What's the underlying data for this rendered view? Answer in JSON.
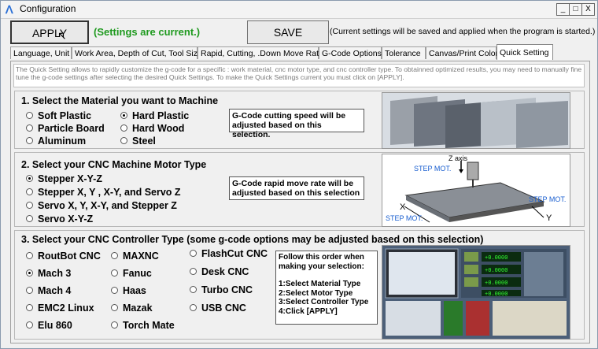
{
  "window": {
    "title": "Configuration",
    "controls": [
      "_",
      "□",
      "X"
    ]
  },
  "toolbar": {
    "apply_label": "APPLY",
    "status": "(Settings are current.)",
    "save_label": "SAVE",
    "save_note": "(Current settings will be saved and applied when the program is started.)"
  },
  "tabs": [
    "Language, Unit",
    "Work Area, Depth of Cut, Tool Size",
    "Rapid, Cutting, .Down Move Rate",
    "G-Code Options",
    "Tolerance",
    "Canvas/Print Color",
    "Quick Setting"
  ],
  "active_tab": "Quick Setting",
  "description": "The Quick Setting allows to rapidly customize the g-code for a specific : work material, cnc motor type, and cnc controller type. To obtainned optimized results, you may need to manually  fine tune the g-code settings after selecting the desired Quick Settings. To make the Quick Settings current you must click on [APPLY].",
  "material": {
    "title": "1. Select the Material you want  to Machine",
    "options": [
      "Soft Plastic",
      "Hard Plastic",
      "Particle Board",
      "Hard Wood",
      "Aluminum",
      "Steel"
    ],
    "selected": "Hard Plastic",
    "note": "G-Code cutting speed will be adjusted based on this selection."
  },
  "motor": {
    "title": "2. Select your CNC Machine Motor Type",
    "options": [
      "Stepper X-Y-Z",
      "Stepper X, Y , X-Y, and Servo Z",
      "Servo X, Y, X-Y, and Stepper Z",
      "Servo X-Y-Z"
    ],
    "selected": "Stepper X-Y-Z",
    "note": "G-Code rapid move rate will be adjusted based on this selection",
    "diagram": {
      "z_axis": "Z axis",
      "step_mot": "STEP MOT.",
      "x_label": "X",
      "y_label": "Y"
    }
  },
  "controller": {
    "title": "3. Select your CNC Controller Type (some g-code options may be adjusted based on this selection)",
    "col1": [
      "RoutBot CNC",
      "Mach 3",
      "Mach 4",
      "EMC2 Linux",
      "Elu 860"
    ],
    "col2": [
      "MAXNC",
      "Fanuc",
      "Haas",
      "Mazak",
      "Torch Mate"
    ],
    "col3": [
      "FlashCut CNC",
      "Desk CNC",
      "Turbo CNC",
      "USB CNC"
    ],
    "selected": "Mach 3",
    "note_lines": [
      "Follow this order when making your selection:",
      "",
      "1:Select Material Type",
      "2:Select Motor Type",
      "3:Select Controller Type",
      "4:Click [APPLY]"
    ],
    "screen_values": [
      "+0.0000",
      "+0.0000",
      "+0.0000",
      "+0.0000"
    ]
  }
}
